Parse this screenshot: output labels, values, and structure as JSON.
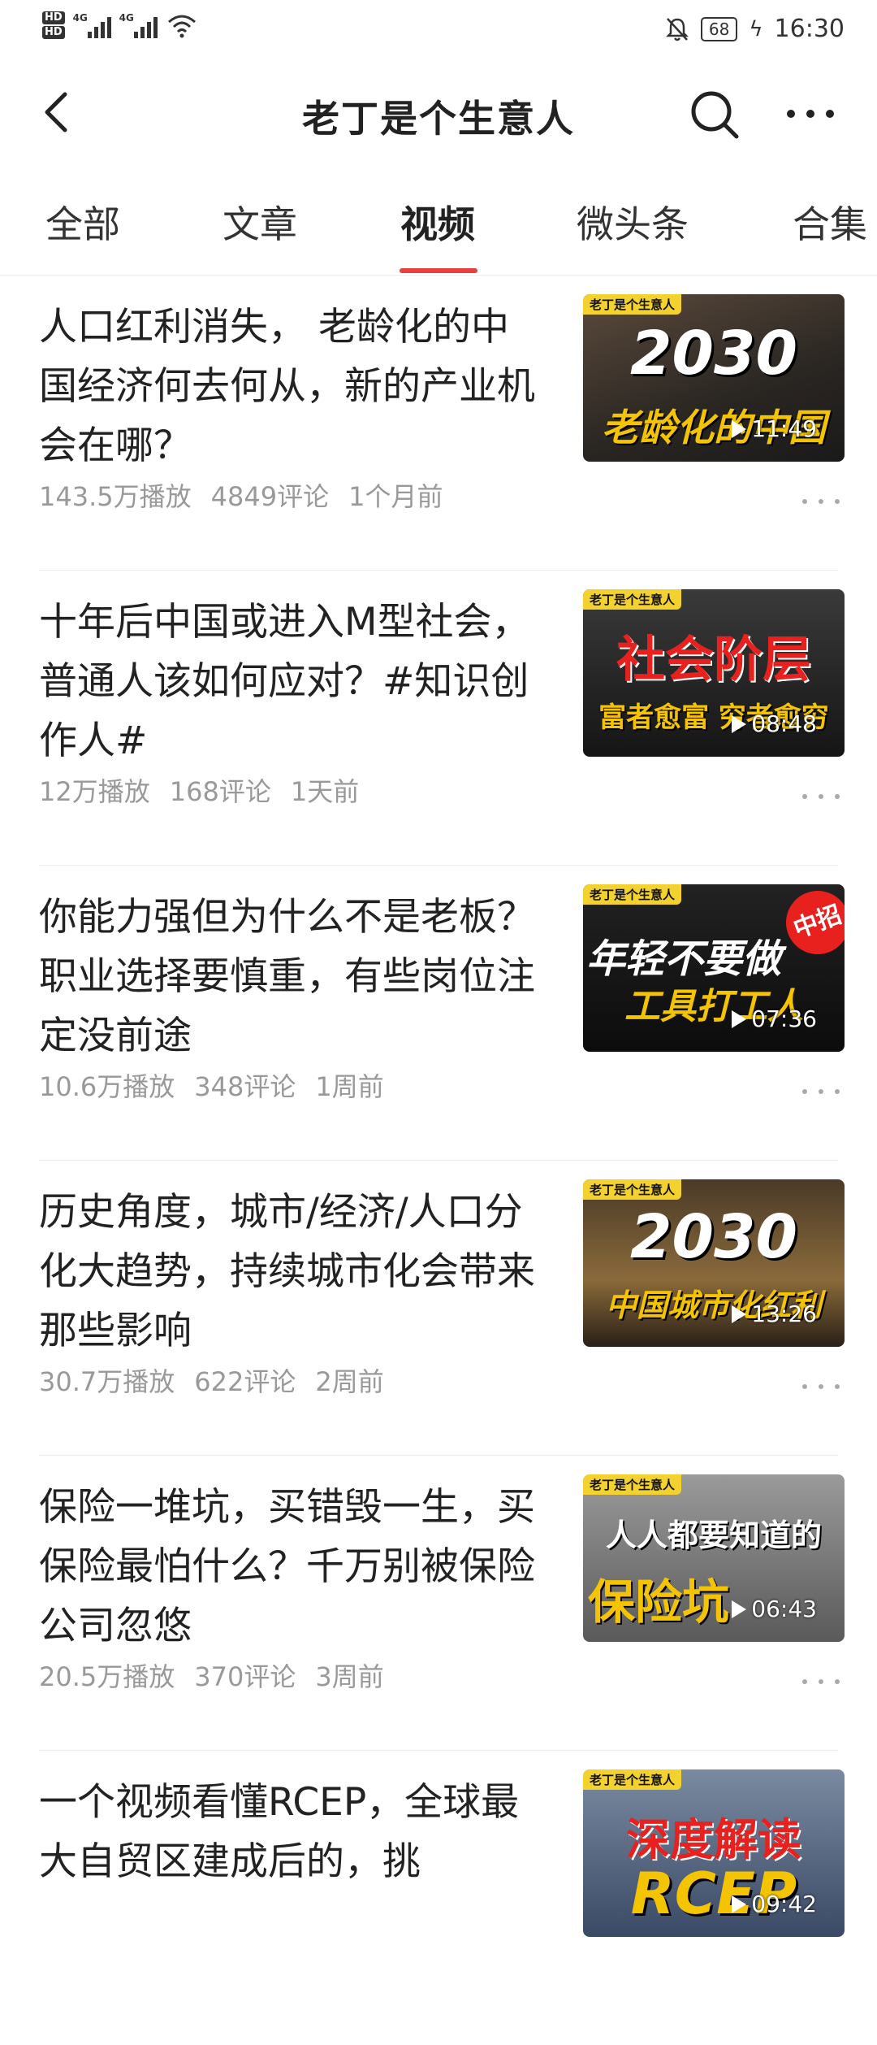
{
  "status": {
    "hd1": "HD",
    "hd2": "HD",
    "net1": "4G",
    "net2": "4G",
    "battery": "68",
    "time": "16:30"
  },
  "header": {
    "title": "老丁是个生意人"
  },
  "tabs": [
    {
      "label": "全部"
    },
    {
      "label": "文章"
    },
    {
      "label": "视频"
    },
    {
      "label": "微头条"
    },
    {
      "label": "合集"
    }
  ],
  "active_tab": "视频",
  "colors": {
    "accent": "#e8403e",
    "meta": "#999999",
    "brand_tag": "#f3d230"
  },
  "videos": [
    {
      "title": "人口红利消失， 老龄化的中国经济何去何从，新的产业机会在哪？",
      "plays": "143.5万播放",
      "comments": "4849评论",
      "time": "1个月前",
      "thumb": {
        "brand": "老丁是个生意人",
        "line1": "2030",
        "line2": "老龄化的中国",
        "duration": "11:49"
      }
    },
    {
      "title": "十年后中国或进入M型社会，普通人该如何应对？#知识创作人#",
      "plays": "12万播放",
      "comments": "168评论",
      "time": "1天前",
      "thumb": {
        "brand": "老丁是个生意人",
        "line1": "社会阶层",
        "line2": "富者愈富 穷者愈穷",
        "duration": "08:48"
      }
    },
    {
      "title": "你能力强但为什么不是老板？职业选择要慎重，有些岗位注定没前途",
      "plays": "10.6万播放",
      "comments": "348评论",
      "time": "1周前",
      "thumb": {
        "brand": "老丁是个生意人",
        "line1": "年轻不要做",
        "line2": "工具打工人",
        "tag": "中招",
        "duration": "07:36"
      }
    },
    {
      "title": "历史角度，城市/经济/人口分化大趋势，持续城市化会带来那些影响",
      "plays": "30.7万播放",
      "comments": "622评论",
      "time": "2周前",
      "thumb": {
        "brand": "老丁是个生意人",
        "line1": "2030",
        "line2": "中国城市化红利",
        "duration": "13:26"
      }
    },
    {
      "title": "保险一堆坑，买错毁一生，买保险最怕什么？千万别被保险公司忽悠",
      "plays": "20.5万播放",
      "comments": "370评论",
      "time": "3周前",
      "thumb": {
        "brand": "老丁是个生意人",
        "line1": "人人都要知道的",
        "line2": "保险坑",
        "duration": "06:43"
      }
    },
    {
      "title": "一个视频看懂RCEP，全球最大自贸区建成后的，挑",
      "plays": "",
      "comments": "",
      "time": "",
      "thumb": {
        "brand": "老丁是个生意人",
        "line1": "深度解读",
        "line2": "RCEP",
        "duration": "09:42"
      }
    }
  ]
}
